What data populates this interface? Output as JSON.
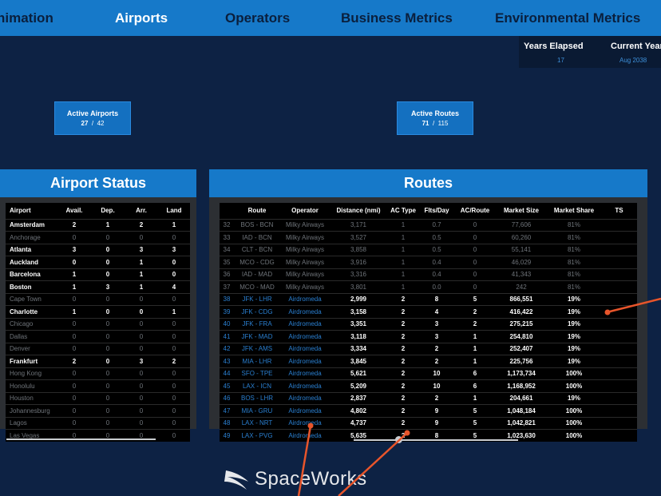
{
  "nav": {
    "tabs": [
      {
        "label": "nimation"
      },
      {
        "label": "Airports"
      },
      {
        "label": "Operators"
      },
      {
        "label": "Business Metrics"
      },
      {
        "label": "Environmental Metrics"
      }
    ]
  },
  "timeline": {
    "years_label": "Years Elapsed",
    "years_value": "17",
    "year_label": "Current Year",
    "year_value": "Aug 2038"
  },
  "active_airports": {
    "label": "Active Airports",
    "active": "27",
    "sep": "/",
    "total": "42"
  },
  "active_routes": {
    "label": "Active Routes",
    "active": "71",
    "sep": "/",
    "total": "115"
  },
  "airport_status": {
    "title": "Airport Status",
    "columns": [
      "Airport",
      "Avail.",
      "Dep.",
      "Arr.",
      "Land"
    ],
    "rows": [
      {
        "cells": [
          "Amsterdam",
          "2",
          "1",
          "2",
          "1"
        ],
        "active": true
      },
      {
        "cells": [
          "Anchorage",
          "0",
          "0",
          "0",
          "0"
        ],
        "active": false
      },
      {
        "cells": [
          "Atlanta",
          "3",
          "0",
          "3",
          "3"
        ],
        "active": true
      },
      {
        "cells": [
          "Auckland",
          "0",
          "0",
          "1",
          "0"
        ],
        "active": true
      },
      {
        "cells": [
          "Barcelona",
          "1",
          "0",
          "1",
          "0"
        ],
        "active": true
      },
      {
        "cells": [
          "Boston",
          "1",
          "3",
          "1",
          "4"
        ],
        "active": true
      },
      {
        "cells": [
          "Cape Town",
          "0",
          "0",
          "0",
          "0"
        ],
        "active": false
      },
      {
        "cells": [
          "Charlotte",
          "1",
          "0",
          "0",
          "1"
        ],
        "active": true
      },
      {
        "cells": [
          "Chicago",
          "0",
          "0",
          "0",
          "0"
        ],
        "active": false
      },
      {
        "cells": [
          "Dallas",
          "0",
          "0",
          "0",
          "0"
        ],
        "active": false
      },
      {
        "cells": [
          "Denver",
          "0",
          "0",
          "0",
          "0"
        ],
        "active": false
      },
      {
        "cells": [
          "Frankfurt",
          "2",
          "0",
          "3",
          "2"
        ],
        "active": true
      },
      {
        "cells": [
          "Hong Kong",
          "0",
          "0",
          "0",
          "0"
        ],
        "active": false
      },
      {
        "cells": [
          "Honolulu",
          "0",
          "0",
          "0",
          "0"
        ],
        "active": false
      },
      {
        "cells": [
          "Houston",
          "0",
          "0",
          "0",
          "0"
        ],
        "active": false
      },
      {
        "cells": [
          "Johannesburg",
          "0",
          "0",
          "0",
          "0"
        ],
        "active": false
      },
      {
        "cells": [
          "Lagos",
          "0",
          "0",
          "0",
          "0"
        ],
        "active": false
      },
      {
        "cells": [
          "Las Vegas",
          "0",
          "0",
          "0",
          "0"
        ],
        "active": false
      }
    ]
  },
  "routes": {
    "title": "Routes",
    "columns": [
      "",
      "Route",
      "Operator",
      "Distance (nmi)",
      "AC Type",
      "Flts/Day",
      "AC/Route",
      "Market Size",
      "Market Share",
      "TS"
    ],
    "rows": [
      {
        "cells": [
          "32",
          "BOS - BCN",
          "Milky Airways",
          "3,171",
          "1",
          "0.7",
          "0",
          "77,606",
          "81%",
          ""
        ],
        "active": false
      },
      {
        "cells": [
          "33",
          "IAD - BCN",
          "Milky Airways",
          "3,527",
          "1",
          "0.5",
          "0",
          "60,260",
          "81%",
          ""
        ],
        "active": false
      },
      {
        "cells": [
          "34",
          "CLT - BCN",
          "Milky Airways",
          "3,858",
          "1",
          "0.5",
          "0",
          "55,141",
          "81%",
          ""
        ],
        "active": false
      },
      {
        "cells": [
          "35",
          "MCO - CDG",
          "Milky Airways",
          "3,916",
          "1",
          "0.4",
          "0",
          "46,029",
          "81%",
          ""
        ],
        "active": false
      },
      {
        "cells": [
          "36",
          "IAD - MAD",
          "Milky Airways",
          "3,316",
          "1",
          "0.4",
          "0",
          "41,343",
          "81%",
          ""
        ],
        "active": false
      },
      {
        "cells": [
          "37",
          "MCO - MAD",
          "Milky Airways",
          "3,801",
          "1",
          "0.0",
          "0",
          "242",
          "81%",
          ""
        ],
        "active": false
      },
      {
        "cells": [
          "38",
          "JFK - LHR",
          "Airdromeda",
          "2,999",
          "2",
          "8",
          "5",
          "866,551",
          "19%",
          ""
        ],
        "active": true
      },
      {
        "cells": [
          "39",
          "JFK - CDG",
          "Airdromeda",
          "3,158",
          "2",
          "4",
          "2",
          "416,422",
          "19%",
          ""
        ],
        "active": true
      },
      {
        "cells": [
          "40",
          "JFK - FRA",
          "Airdromeda",
          "3,351",
          "2",
          "3",
          "2",
          "275,215",
          "19%",
          ""
        ],
        "active": true
      },
      {
        "cells": [
          "41",
          "JFK - MAD",
          "Airdromeda",
          "3,118",
          "2",
          "3",
          "1",
          "254,810",
          "19%",
          ""
        ],
        "active": true
      },
      {
        "cells": [
          "42",
          "JFK - AMS",
          "Airdromeda",
          "3,334",
          "2",
          "2",
          "1",
          "252,407",
          "19%",
          ""
        ],
        "active": true
      },
      {
        "cells": [
          "43",
          "MIA - LHR",
          "Airdromeda",
          "3,845",
          "2",
          "2",
          "1",
          "225,756",
          "19%",
          ""
        ],
        "active": true
      },
      {
        "cells": [
          "44",
          "SFO - TPE",
          "Airdromeda",
          "5,621",
          "2",
          "10",
          "6",
          "1,173,734",
          "100%",
          ""
        ],
        "active": true
      },
      {
        "cells": [
          "45",
          "LAX - ICN",
          "Airdromeda",
          "5,209",
          "2",
          "10",
          "6",
          "1,168,952",
          "100%",
          ""
        ],
        "active": true
      },
      {
        "cells": [
          "46",
          "BOS - LHR",
          "Airdromeda",
          "2,837",
          "2",
          "2",
          "1",
          "204,661",
          "19%",
          ""
        ],
        "active": true
      },
      {
        "cells": [
          "47",
          "MIA - GRU",
          "Airdromeda",
          "4,802",
          "2",
          "9",
          "5",
          "1,048,184",
          "100%",
          ""
        ],
        "active": true
      },
      {
        "cells": [
          "48",
          "LAX - NRT",
          "Airdromeda",
          "4,737",
          "2",
          "9",
          "5",
          "1,042,821",
          "100%",
          ""
        ],
        "active": true
      },
      {
        "cells": [
          "49",
          "LAX - PVG",
          "Airdromeda",
          "5,635",
          "2",
          "8",
          "5",
          "1,023,630",
          "100%",
          ""
        ],
        "active": true
      }
    ]
  },
  "logo": {
    "text": "SpaceWorks"
  },
  "colors": {
    "accent": "#1679c9",
    "background": "#0d2244",
    "link": "#2a7fd0",
    "annotation": "#e8552b"
  }
}
